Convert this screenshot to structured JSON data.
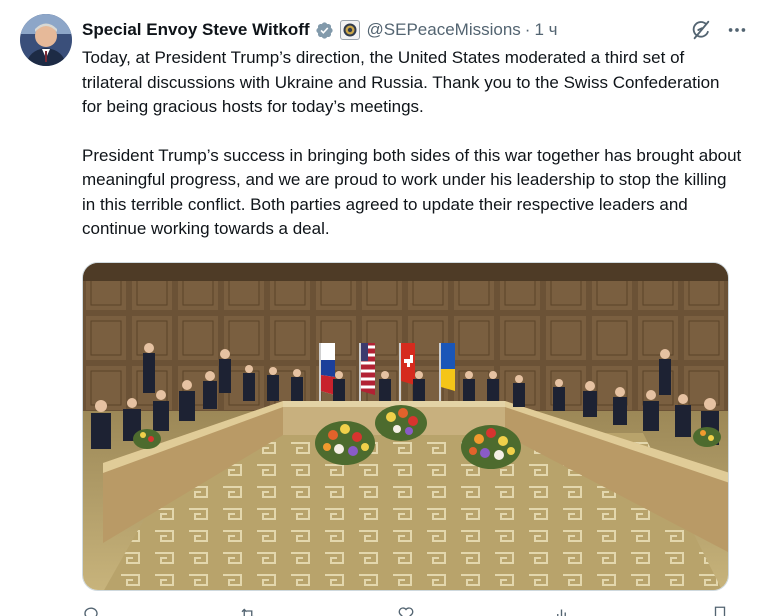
{
  "author": {
    "name": "Special Envoy Steve Witkoff",
    "handle": "@SEPeaceMissions",
    "separator": "·",
    "time": "1 ч"
  },
  "post": {
    "paragraph1": "Today, at President Trump’s direction, the United States moderated a third set of trilateral discussions with Ukraine and Russia. Thank you to the Swiss Confederation for being gracious hosts for today’s meetings.",
    "paragraph2": "President Trump’s success in bringing both sides of this war together has brought about meaningful progress, and we are proud to work under his leadership to stop the killing in this terrible conflict. Both parties agreed to update their respective leaders and continue working towards a deal."
  },
  "icons": {
    "verified": "verified-badge-icon",
    "government": "government-seal-icon",
    "grok": "grok-icon",
    "more": "more-icon",
    "reply": "reply-icon",
    "repost": "repost-icon",
    "like": "like-icon",
    "views": "views-icon",
    "bookmark": "bookmark-icon",
    "share": "share-icon"
  },
  "colors": {
    "text": "#0f1419",
    "secondary": "#536471",
    "verified": "#829aab",
    "border": "#cfd9de"
  }
}
